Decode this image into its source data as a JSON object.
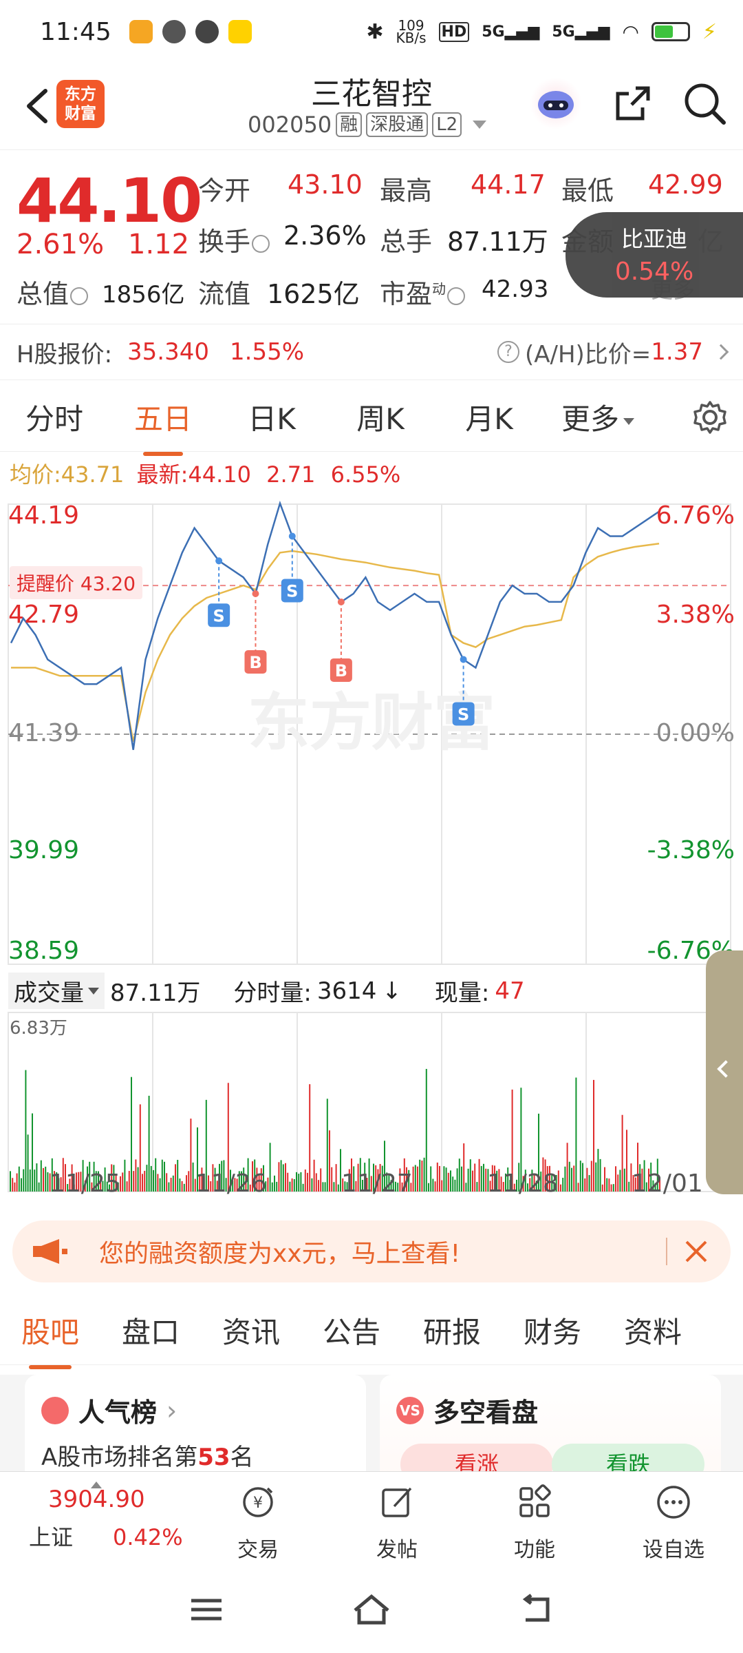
{
  "status_bar": {
    "time": "11:45",
    "net_speed_top": "109",
    "net_speed_bottom": "KB/s",
    "battery_level": 0.55
  },
  "header": {
    "logo_line1": "东方",
    "logo_line2": "财富",
    "title": "三花智控",
    "code": "002050",
    "tags": [
      "融",
      "深股通",
      "L2"
    ]
  },
  "quote": {
    "price": "44.10",
    "change_pct": "2.61%",
    "change_abs": "1.12",
    "open_label": "今开",
    "open": "43.10",
    "high_label": "最高",
    "high": "44.17",
    "low_label": "最低",
    "low": "42.99",
    "turnover_label": "换手",
    "turnover": "2.36%",
    "volume_label": "总手",
    "volume": "87.11万",
    "amount_label": "金额",
    "amount_tail": "亿",
    "mktcap_label": "总值",
    "mktcap": "1856亿",
    "float_label": "流值",
    "float_cap": "1625亿",
    "pe_label": "市盈",
    "pe_sup": "动",
    "pe": "42.93",
    "more": "更多",
    "byd_name": "比亚迪",
    "byd_pct": "0.54%"
  },
  "hshare": {
    "label": "H股报价:",
    "price": "35.340",
    "pct": "1.55%",
    "ratio_label": "(A/H)比价=",
    "ratio": "1.37"
  },
  "period_tabs": [
    "分时",
    "五日",
    "日K",
    "周K",
    "月K",
    "更多"
  ],
  "avg": {
    "avg_label": "均价:",
    "avg": "43.71",
    "last_label": "最新:",
    "last": "44.10",
    "chg": "2.71",
    "pct": "6.55%"
  },
  "chart_data": {
    "type": "line",
    "title": "",
    "x": [
      "11/25",
      "11/26",
      "11/27",
      "11/28",
      "12/01"
    ],
    "y_left_ticks": [
      "44.19",
      "42.79",
      "41.39",
      "39.99",
      "38.59"
    ],
    "y_right_ticks": [
      "6.76%",
      "3.38%",
      "0.00%",
      "-3.38%",
      "-6.76%"
    ],
    "ylim": [
      38.59,
      44.19
    ],
    "prev_close": 41.39,
    "alert_label": "提醒价 43.20",
    "alert_price": 43.2,
    "series": [
      {
        "values": [
          42.5,
          42.8,
          42.6,
          42.3,
          42.2,
          42.1,
          42.0,
          42.0,
          42.1,
          42.2,
          41.2,
          42.3,
          42.8,
          43.2,
          43.6,
          43.9,
          43.7,
          43.5,
          43.4,
          43.3,
          43.1,
          43.7,
          44.2,
          43.8,
          43.6,
          43.4,
          43.2,
          43.0,
          43.1,
          43.3,
          43.0,
          42.9,
          43.0,
          43.1,
          43.0,
          43.0,
          42.6,
          42.3,
          42.2,
          42.6,
          43.0,
          43.2,
          43.1,
          43.1,
          43.0,
          43.0,
          43.2,
          43.6,
          43.9,
          43.8,
          43.8,
          43.9,
          44.0,
          44.1
        ]
      },
      {
        "values": [
          42.2,
          42.2,
          42.2,
          42.15,
          42.1,
          42.1,
          42.1,
          42.1,
          42.1,
          42.1,
          41.3,
          41.9,
          42.3,
          42.6,
          42.8,
          42.95,
          43.05,
          43.1,
          43.15,
          43.2,
          43.15,
          43.4,
          43.6,
          43.62,
          43.6,
          43.58,
          43.55,
          43.52,
          43.5,
          43.48,
          43.45,
          43.42,
          43.4,
          43.38,
          43.35,
          43.33,
          42.6,
          42.5,
          42.45,
          42.55,
          42.6,
          42.65,
          42.7,
          42.72,
          42.75,
          42.78,
          43.3,
          43.45,
          43.55,
          43.6,
          43.64,
          43.67,
          43.69,
          43.71
        ]
      }
    ],
    "markers": [
      {
        "type": "S",
        "x_index": 17
      },
      {
        "type": "B",
        "x_index": 20
      },
      {
        "type": "S",
        "x_index": 23
      },
      {
        "type": "B",
        "x_index": 27
      },
      {
        "type": "S",
        "x_index": 37
      }
    ]
  },
  "volume": {
    "label": "成交量",
    "total": "87.11万",
    "tick_label": "分时量:",
    "tick": "3614",
    "now_label": "现量:",
    "now": "47",
    "max": "6.83万"
  },
  "promo": {
    "text": "您的融资额度为xx元，马上查看!"
  },
  "section_tabs": [
    "股吧",
    "盘口",
    "资讯",
    "公告",
    "研报",
    "财务",
    "资料"
  ],
  "cards": {
    "rank_title": "人气榜",
    "rank_prefix": "A股市场排名第",
    "rank_value": "53",
    "rank_suffix": "名",
    "bull_bear_title": "多空看盘",
    "vs_badge": "VS",
    "up_label": "看涨",
    "down_label": "看跌"
  },
  "bottom_nav": {
    "index_value": "3904.90",
    "index_name": "上证",
    "index_pct": "0.42%",
    "items": [
      "交易",
      "发帖",
      "功能",
      "设自选"
    ]
  },
  "colors": {
    "up": "#e02b2b",
    "down": "#12942f",
    "accent": "#e8632a",
    "avg_line": "#e7b84a",
    "price_line": "#3c6fb4"
  }
}
